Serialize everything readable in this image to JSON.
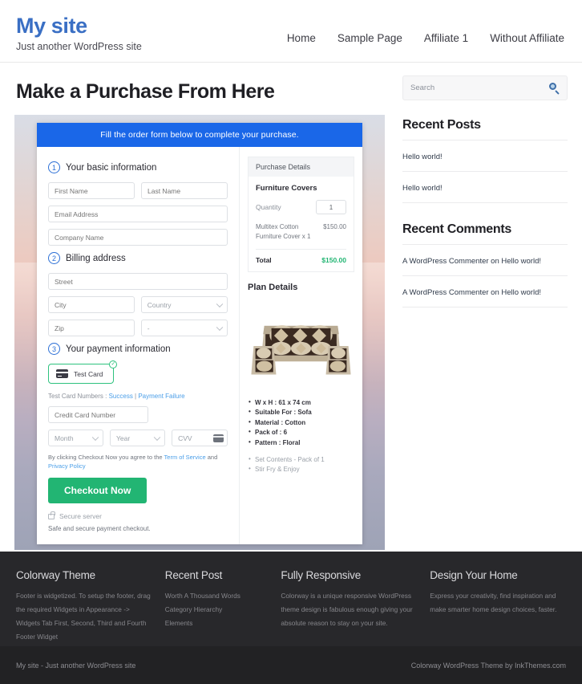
{
  "header": {
    "site_title": "My site",
    "tagline": "Just another WordPress site",
    "nav": [
      {
        "label": "Home"
      },
      {
        "label": "Sample Page"
      },
      {
        "label": "Affiliate 1"
      },
      {
        "label": "Without Affiliate"
      }
    ]
  },
  "main": {
    "page_title": "Make a Purchase From Here",
    "form": {
      "banner": "Fill the order form below to complete your purchase.",
      "step1": {
        "number": "1",
        "label": "Your basic information",
        "first_name_placeholder": "First Name",
        "last_name_placeholder": "Last Name",
        "email_placeholder": "Email Address",
        "company_placeholder": "Company Name"
      },
      "step2": {
        "number": "2",
        "label": "Billing address",
        "street_placeholder": "Street",
        "city_placeholder": "City",
        "country_placeholder": "Country",
        "zip_placeholder": "Zip",
        "state_placeholder": "-"
      },
      "step3": {
        "number": "3",
        "label": "Your payment information",
        "card_tab_label": "Test Card",
        "card_tab_check": "✓",
        "test_cards_prefix": "Test Card Numbers : ",
        "test_cards_success": "Success",
        "test_cards_divider": " | ",
        "test_cards_failure": "Payment Failure",
        "card_number_placeholder": "Credit Card Number",
        "month_placeholder": "Month",
        "year_placeholder": "Year",
        "cvv_placeholder": "CVV",
        "terms_prefix": "By clicking Checkout Now you agree to the ",
        "terms_tos": "Term of Service",
        "terms_and": " and ",
        "terms_privacy": "Privacy Policy",
        "checkout_label": "Checkout Now",
        "secure_server": "Secure server",
        "safe_text": "Safe and secure payment checkout."
      },
      "purchase": {
        "heading": "Purchase Details",
        "product_name": "Furniture Covers",
        "quantity_label": "Quantity",
        "quantity_value": "1",
        "line_item": "Multitex Cotton Furniture Cover x 1",
        "line_price": "$150.00",
        "total_label": "Total",
        "total_value": "$150.00"
      },
      "plan": {
        "heading": "Plan Details",
        "specs": [
          "W x H : 61 x 74 cm",
          "Suitable For : Sofa",
          "Material : Cotton",
          "Pack of : 6",
          "Pattern : Floral"
        ],
        "extras": [
          "Set Contents - Pack of 1",
          "Stir Fry & Enjoy"
        ]
      }
    }
  },
  "sidebar": {
    "search_placeholder": "Search",
    "recent_posts": {
      "title": "Recent Posts",
      "items": [
        {
          "label": "Hello world!"
        },
        {
          "label": "Hello world!"
        }
      ]
    },
    "recent_comments": {
      "title": "Recent Comments",
      "items": [
        {
          "label": "A WordPress Commenter on Hello world!"
        },
        {
          "label": "A WordPress Commenter on Hello world!"
        }
      ]
    }
  },
  "footer": {
    "columns": [
      {
        "title": "Colorway Theme",
        "text": "Footer is widgetized. To setup the footer, drag the required Widgets in Appearance -> Widgets Tab First, Second, Third and Fourth Footer Widget"
      },
      {
        "title": "Recent Post",
        "items": [
          {
            "label": "Worth A Thousand Words"
          },
          {
            "label": "Category Hierarchy"
          },
          {
            "label": "Elements"
          }
        ]
      },
      {
        "title": "Fully Responsive",
        "text": "Colorway is a unique responsive WordPress theme design is fabulous enough giving your absolute reason to stay on your site."
      },
      {
        "title": "Design Your Home",
        "text": "Express your creativity, find inspiration and make smarter home design choices, faster."
      }
    ],
    "copyright_left": "My site - Just another WordPress site",
    "copyright_right": "Colorway WordPress Theme by InkThemes.com"
  },
  "colors": {
    "brand_blue": "#3a6fc4",
    "banner_blue": "#1a67e8",
    "green": "#22b573",
    "footer_dark": "#28282b"
  }
}
